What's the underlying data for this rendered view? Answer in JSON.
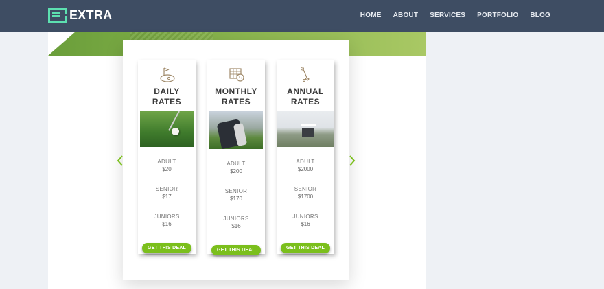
{
  "brand": {
    "name": "EXTRA"
  },
  "nav": {
    "items": [
      {
        "label": "HOME"
      },
      {
        "label": "ABOUT"
      },
      {
        "label": "SERVICES"
      },
      {
        "label": "PORTFOLIO"
      },
      {
        "label": "BLOG"
      }
    ]
  },
  "colors": {
    "topbar": "#3e4d63",
    "logo_accent": "#5de0b0",
    "button": "#7bbf1c",
    "arrow": "#7bbf1c"
  },
  "cards": [
    {
      "icon": "golf-flag-icon",
      "title_line1": "DAILY RATES",
      "title_line2": "",
      "rates": [
        {
          "label": "ADULT",
          "price": "$20"
        },
        {
          "label": "SENIOR",
          "price": "$17"
        },
        {
          "label": "JUNIORS",
          "price": "$16"
        }
      ],
      "button": "GET THIS DEAL"
    },
    {
      "icon": "golf-basket-icon",
      "title_line1": "MONTHLY",
      "title_line2": "RATES",
      "rates": [
        {
          "label": "ADULT",
          "price": "$200"
        },
        {
          "label": "SENIOR",
          "price": "$170"
        },
        {
          "label": "JUNIORS",
          "price": "$16"
        }
      ],
      "button": "GET THIS DEAL"
    },
    {
      "icon": "golf-club-icon",
      "title_line1": "ANNUAL",
      "title_line2": "RATES",
      "rates": [
        {
          "label": "ADULT",
          "price": "$2000"
        },
        {
          "label": "SENIOR",
          "price": "$1700"
        },
        {
          "label": "JUNIORS",
          "price": "$16"
        }
      ],
      "button": "GET THIS DEAL"
    }
  ]
}
